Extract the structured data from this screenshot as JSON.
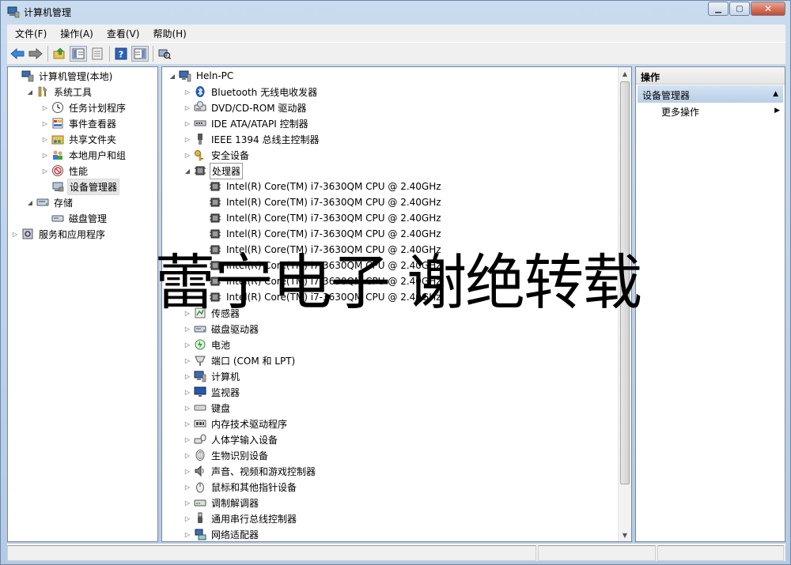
{
  "window": {
    "title": "计算机管理",
    "buttons": {
      "minimize": "▁",
      "maximize": "▢",
      "close": "✕"
    }
  },
  "menu": [
    "文件(F)",
    "操作(A)",
    "查看(V)",
    "帮助(H)"
  ],
  "toolbar": [
    "back-arrow-icon",
    "forward-arrow-icon",
    "up-folder-icon",
    "show-hide-tree-icon",
    "properties-icon",
    "help-icon",
    "show-hide-action-pane-icon",
    "scan-hardware-icon"
  ],
  "left_tree": [
    {
      "label": "计算机管理(本地)",
      "toggle": "",
      "icon": "computer-management-icon"
    },
    {
      "label": "系统工具",
      "toggle": "◢",
      "icon": "tools-icon"
    },
    {
      "label": "任务计划程序",
      "toggle": "▷",
      "icon": "clock-icon"
    },
    {
      "label": "事件查看器",
      "toggle": "▷",
      "icon": "event-log-icon"
    },
    {
      "label": "共享文件夹",
      "toggle": "▷",
      "icon": "shared-folder-icon"
    },
    {
      "label": "本地用户和组",
      "toggle": "▷",
      "icon": "users-icon"
    },
    {
      "label": "性能",
      "toggle": "▷",
      "icon": "performance-icon"
    },
    {
      "label": "设备管理器",
      "toggle": "",
      "icon": "device-manager-icon"
    },
    {
      "label": "存储",
      "toggle": "◢",
      "icon": "storage-icon"
    },
    {
      "label": "磁盘管理",
      "toggle": "",
      "icon": "disk-icon"
    },
    {
      "label": "服务和应用程序",
      "toggle": "▷",
      "icon": "services-icon"
    }
  ],
  "device_tree": [
    {
      "label": "Heln-PC",
      "toggle": "◢",
      "icon": "computer-icon"
    },
    {
      "label": "Bluetooth 无线电收发器",
      "toggle": "▷",
      "icon": "bluetooth-icon"
    },
    {
      "label": "DVD/CD-ROM 驱动器",
      "toggle": "▷",
      "icon": "dvd-drive-icon"
    },
    {
      "label": "IDE ATA/ATAPI 控制器",
      "toggle": "▷",
      "icon": "ide-controller-icon"
    },
    {
      "label": "IEEE 1394 总线主控制器",
      "toggle": "▷",
      "icon": "firewire-icon"
    },
    {
      "label": "安全设备",
      "toggle": "▷",
      "icon": "key-icon"
    },
    {
      "label": "处理器",
      "toggle": "◢",
      "icon": "processor-icon"
    },
    {
      "label": "Intel(R) Core(TM) i7-3630QM CPU @ 2.40GHz",
      "toggle": "",
      "icon": "cpu-icon"
    },
    {
      "label": "Intel(R) Core(TM) i7-3630QM CPU @ 2.40GHz",
      "toggle": "",
      "icon": "cpu-icon"
    },
    {
      "label": "Intel(R) Core(TM) i7-3630QM CPU @ 2.40GHz",
      "toggle": "",
      "icon": "cpu-icon"
    },
    {
      "label": "Intel(R) Core(TM) i7-3630QM CPU @ 2.40GHz",
      "toggle": "",
      "icon": "cpu-icon"
    },
    {
      "label": "Intel(R) Core(TM) i7-3630QM CPU @ 2.40GHz",
      "toggle": "",
      "icon": "cpu-icon"
    },
    {
      "label": "Intel(R) Core(TM) i7-3630QM CPU @ 2.40GHz",
      "toggle": "",
      "icon": "cpu-icon"
    },
    {
      "label": "Intel(R) Core(TM) i7-3630QM CPU @ 2.40GHz",
      "toggle": "",
      "icon": "cpu-icon"
    },
    {
      "label": "Intel(R) Core(TM) i7-3630QM CPU @ 2.40GHz",
      "toggle": "",
      "icon": "cpu-icon"
    },
    {
      "label": "传感器",
      "toggle": "▷",
      "icon": "sensor-icon"
    },
    {
      "label": "磁盘驱动器",
      "toggle": "▷",
      "icon": "disk-drive-icon"
    },
    {
      "label": "电池",
      "toggle": "▷",
      "icon": "battery-icon"
    },
    {
      "label": "端口 (COM 和 LPT)",
      "toggle": "▷",
      "icon": "port-icon"
    },
    {
      "label": "计算机",
      "toggle": "▷",
      "icon": "computer-icon"
    },
    {
      "label": "监视器",
      "toggle": "▷",
      "icon": "monitor-icon"
    },
    {
      "label": "键盘",
      "toggle": "▷",
      "icon": "keyboard-icon"
    },
    {
      "label": "内存技术驱动程序",
      "toggle": "▷",
      "icon": "memory-icon"
    },
    {
      "label": "人体学输入设备",
      "toggle": "▷",
      "icon": "hid-icon"
    },
    {
      "label": "生物识别设备",
      "toggle": "▷",
      "icon": "fingerprint-icon"
    },
    {
      "label": "声音、视频和游戏控制器",
      "toggle": "▷",
      "icon": "speaker-icon"
    },
    {
      "label": "鼠标和其他指针设备",
      "toggle": "▷",
      "icon": "mouse-icon"
    },
    {
      "label": "调制解调器",
      "toggle": "▷",
      "icon": "modem-icon"
    },
    {
      "label": "通用串行总线控制器",
      "toggle": "▷",
      "icon": "usb-icon"
    },
    {
      "label": "网络适配器",
      "toggle": "▷",
      "icon": "network-adapter-icon"
    }
  ],
  "actions": {
    "header": "操作",
    "section": "设备管理器",
    "section_caret": "▲",
    "item": "更多操作",
    "item_caret": "▶"
  },
  "scrollbar": {
    "up": "▲",
    "down": "▼"
  },
  "watermark": "蕾宁电子 谢绝转载"
}
